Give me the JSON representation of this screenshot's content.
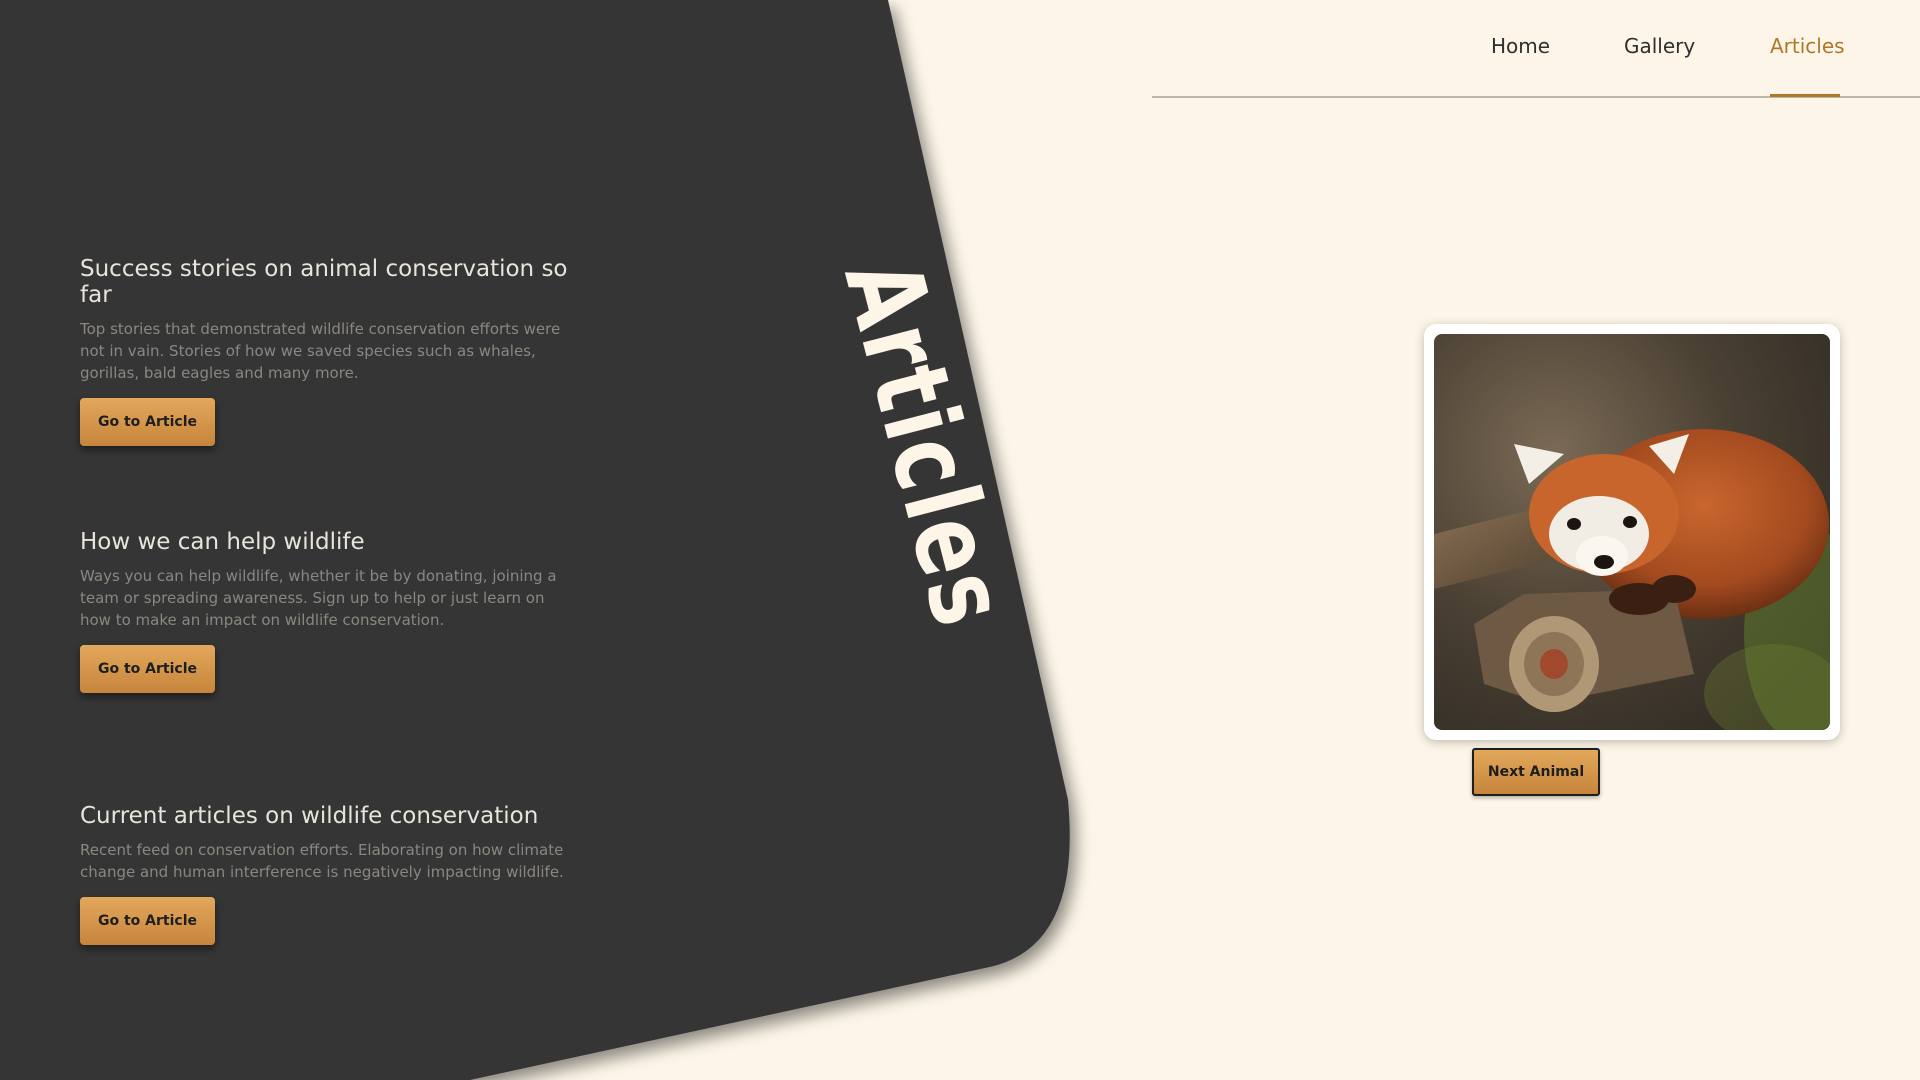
{
  "nav": {
    "home": "Home",
    "gallery": "Gallery",
    "articles": "Articles"
  },
  "section_title": "Articles",
  "articles": [
    {
      "title": "Success stories on animal conservation so far",
      "description": "Top stories that demonstrated wildlife conservation efforts were not in vain. Stories of how we saved species such as whales, gorillas, bald eagles and many more.",
      "button": "Go to Article"
    },
    {
      "title": "How we can help wildlife",
      "description": "Ways you can help wildlife, whether it be by donating, joining a team or spreading awareness. Sign up to help or just learn on how to make an impact on wildlife conservation.",
      "button": "Go to Article"
    },
    {
      "title": "Current articles on wildlife conservation",
      "description": "Recent feed on conservation efforts. Elaborating on how climate change and human interference is negatively impacting wildlife.",
      "button": "Go to Article"
    }
  ],
  "gallery_card": {
    "image_subject": "red panda",
    "next_button": "Next Animal"
  },
  "colors": {
    "background": "#fdf6e8",
    "panel": "#363636",
    "accent": "#b0772b",
    "button": "#d9974a"
  }
}
